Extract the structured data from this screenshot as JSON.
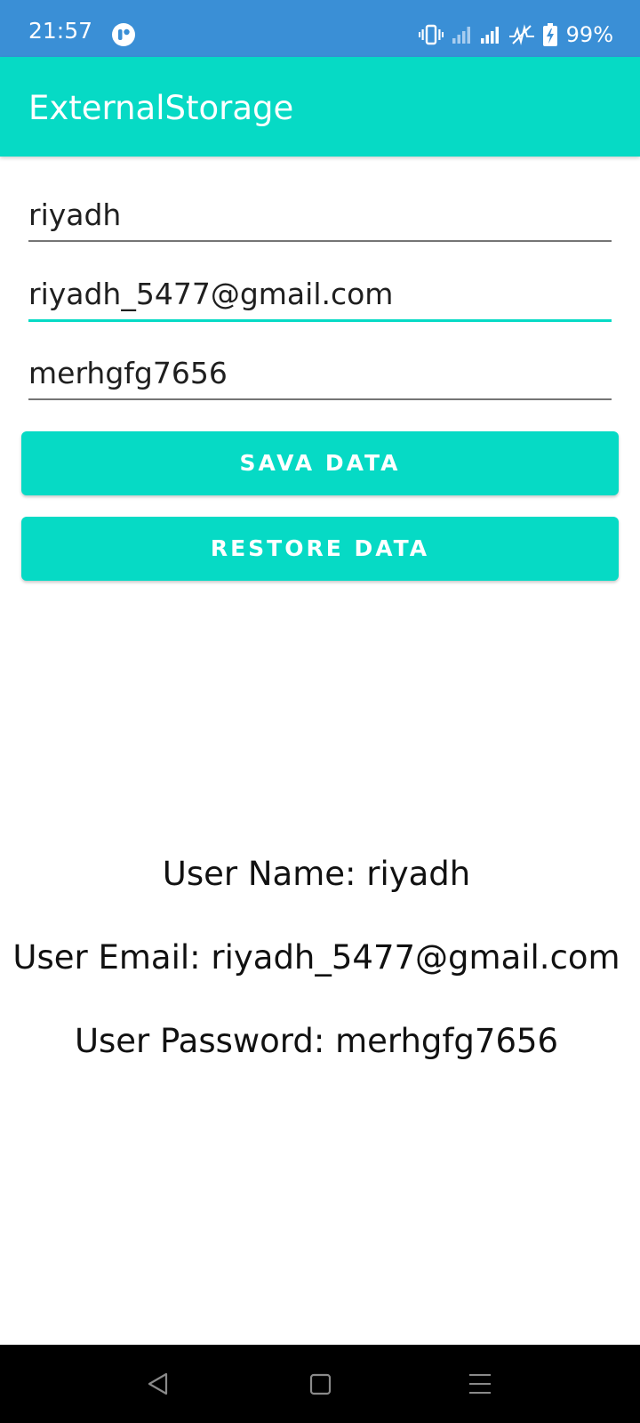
{
  "status_bar": {
    "time": "21:57",
    "battery": "99%",
    "icons": [
      "app-notification-icon",
      "vibrate-icon",
      "signal-weak-icon",
      "signal-strong-icon",
      "activity-icon",
      "battery-charging-icon"
    ],
    "background_color": "#3a8fd6"
  },
  "app_bar": {
    "title": "ExternalStorage",
    "background_color": "#06dac5"
  },
  "form": {
    "name_value": "riyadh",
    "email_value": "riyadh_5477@gmail.com",
    "password_value": "merhgfg7656"
  },
  "buttons": {
    "save_label": "SAVA DATA",
    "restore_label": "RESTORE DATA"
  },
  "results": {
    "user_name": "User Name: riyadh",
    "user_email": "User Email: riyadh_5477@gmail.com",
    "user_password": "User Password: merhgfg7656"
  },
  "nav_bar": {
    "icons": [
      "back-icon",
      "home-icon",
      "recents-icon"
    ]
  },
  "colors": {
    "accent": "#06dac5",
    "status_bar": "#3a8fd6",
    "text": "#1f1f1f"
  }
}
